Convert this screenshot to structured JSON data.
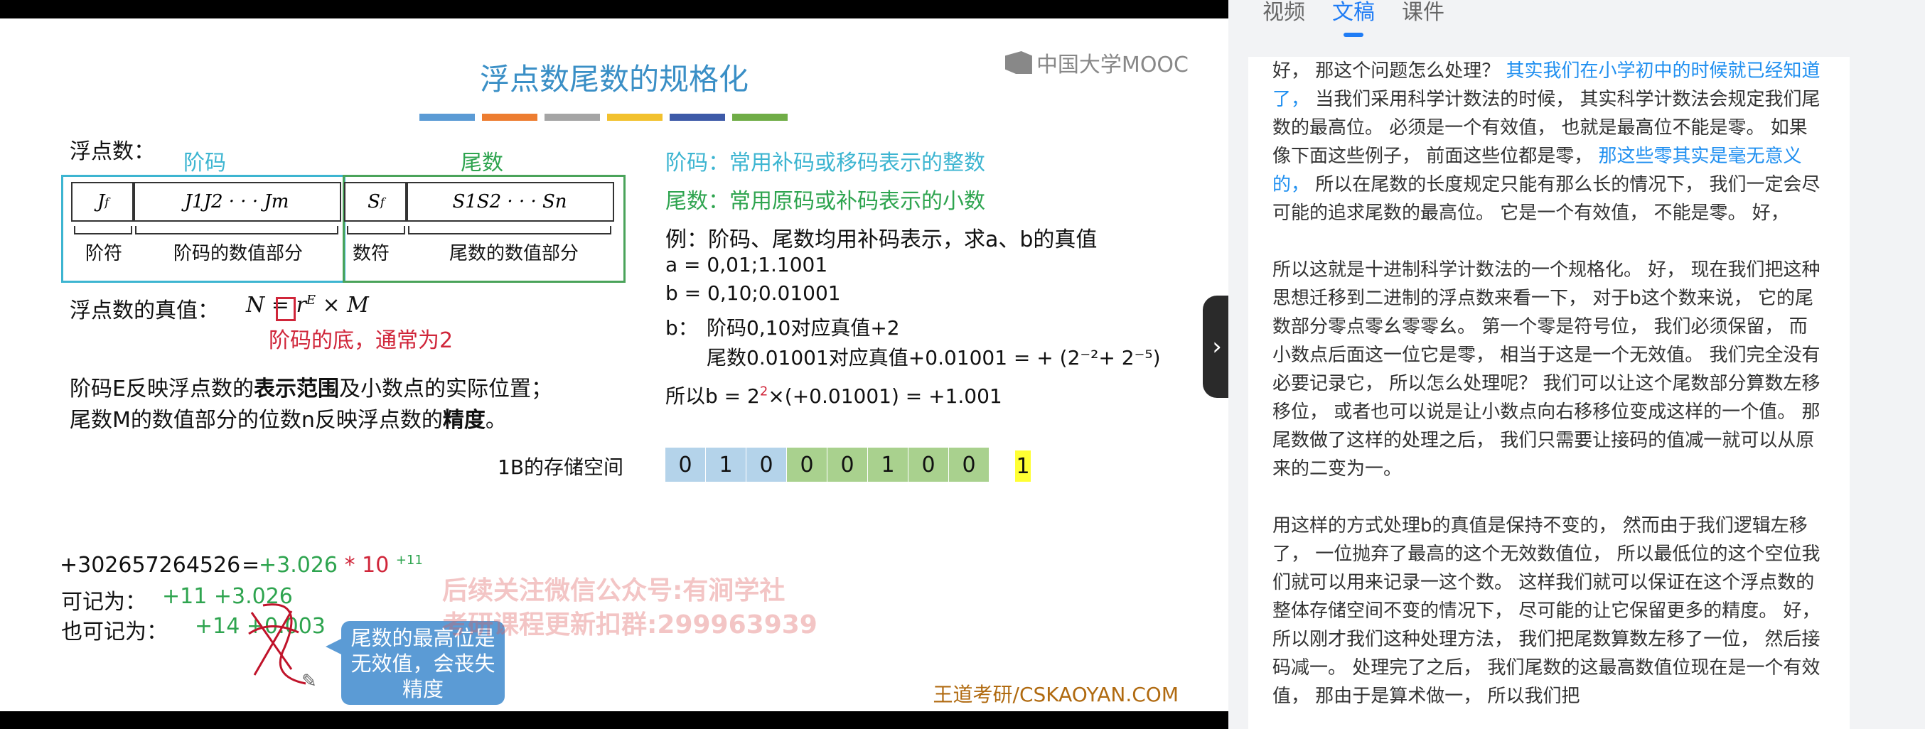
{
  "slide": {
    "title": "浮点数尾数的规格化",
    "title_bar_colors": [
      "#5b9bd5",
      "#ed7d31",
      "#a5a5a5",
      "#f2c12e",
      "#3d5aa8",
      "#70ad47"
    ],
    "logo": "中国大学MOOC",
    "float_label": "浮点数：",
    "jiema_label": "阶码",
    "weishu_label": "尾数",
    "cells": [
      "J",
      "J1J2 · · · Jm",
      "S",
      "S1S2 · · · Sn"
    ],
    "cell_sub_f": "f",
    "under_labels": [
      "阶符",
      "阶码的数值部分",
      "数符",
      "尾数的数值部分"
    ],
    "true_value_label": "浮点数的真值：",
    "formula": "N = r",
    "formula_sup": "E",
    "formula_tail": "× M",
    "base_note": "阶码的底，通常为2",
    "line1_pre": "阶码E反映浮点数的",
    "line1_bold": "表示范围",
    "line1_post": "及小数点的实际位置；",
    "line2_pre": "尾数M的数值部分的位数n反映浮点数的",
    "line2_bold": "精度",
    "line2_post": "。",
    "jiema_desc": "阶码：常用补码或移码表示的整数",
    "weishu_desc": "尾数：常用原码或补码表示的小数",
    "example": "例：阶码、尾数均用补码表示，求a、b的真值",
    "a_val": "a = 0,01;1.1001",
    "b_val": "b = 0,10;0.01001",
    "b_label": "b：",
    "b_line1": "阶码0,10对应真值+2",
    "b_line2": "尾数0.01001对应真值+0.01001 = + (2⁻²+ 2⁻⁵)",
    "result_pre": "所以b = 2",
    "result_sup": "2",
    "result_post": "×(+0.01001) = +1.001",
    "storage_label": "1B的存储空间",
    "bits": [
      {
        "v": "0",
        "c": "#b4d3ea"
      },
      {
        "v": "1",
        "c": "#b4d3ea"
      },
      {
        "v": "0",
        "c": "#b4d3ea"
      },
      {
        "v": "0",
        "c": "#a9d18e"
      },
      {
        "v": "0",
        "c": "#a9d18e"
      },
      {
        "v": "1",
        "c": "#a9d18e"
      },
      {
        "v": "0",
        "c": "#a9d18e"
      },
      {
        "v": "0",
        "c": "#a9d18e"
      }
    ],
    "extra_bit": "1",
    "extra_bit_color": "#ffff33",
    "sci_left": "+302657264526",
    "sci_eq": "=",
    "sci_val": "+3.026",
    "sci_times": "* 10",
    "sci_exp": "+11",
    "rec1_label": "可记为：",
    "rec1_val": "+11 +3.026",
    "rec2_label": "也可记为：",
    "rec2_val": "+14 +0.003",
    "callout": "尾数的最高位是无效值，会丧失精度",
    "watermark1": "后续关注微信公众号:有涧学社",
    "watermark2": "考研课程更新扣群:299963939",
    "footer": "王道考研/CSKAOYAN.COM"
  },
  "panel": {
    "tabs": [
      {
        "label": "视频",
        "active": false
      },
      {
        "label": "文稿",
        "active": true
      },
      {
        "label": "课件",
        "active": false
      }
    ],
    "p1_a": "好， 那这个问题怎么处理？ ",
    "p1_hl1": "其实我们在小学初中的时候就已经知道了，",
    "p1_b": " 当我们采用科学计数法的时候， 其实科学计数法会规定我们尾数的最高位。 必须是一个有效值， 也就是最高位不能是零。 如果像下面这些例子， 前面这些位都是零， ",
    "p1_hl2": "那这些零其实是毫无意义的，",
    "p1_c": " 所以在尾数的长度规定只能有那么长的情况下， 我们一定会尽可能的追求尾数的最高位。 它是一个有效值， 不能是零。 好，",
    "p2": "所以这就是十进制科学计数法的一个规格化。 好， 现在我们把这种思想迁移到二进制的浮点数来看一下， 对于b这个数来说， 它的尾数部分零点零幺零零幺。 第一个零是符号位， 我们必须保留， 而小数点后面这一位它是零， 相当于这是一个无效值。 我们完全没有必要记录它， 所以怎么处理呢？ 我们可以让这个尾数部分算数左移移位， 或者也可以说是让小数点向右移移位变成这样的一个值。 那尾数做了这样的处理之后， 我们只需要让接码的值减一就可以从原来的二变为一。",
    "p3": "用这样的方式处理b的真值是保持不变的， 然而由于我们逻辑左移了， 一位抛弃了最高的这个无效数值位， 所以最低位的这个空位我们就可以用来记录一这个数。 这样我们就可以保证在这个浮点数的整体存储空间不变的情况下， 尽可能的让它保留更多的精度。 好， 所以刚才我们这种处理方法， 我们把尾数算数左移了一位， 然后接码减一。 处理完了之后， 我们尾数的这最高数值位现在是一个有效值， 那由于是算术做一， 所以我们把"
  },
  "colors": {
    "cyan_box": "#3db5d1",
    "green_box": "#4aa35a",
    "accent_blue": "#1f7cf5"
  }
}
